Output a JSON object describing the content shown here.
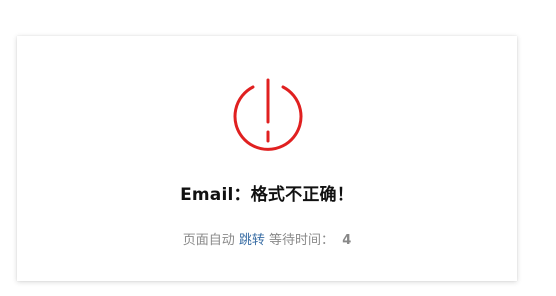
{
  "icon": {
    "name": "power-warning-icon",
    "color": "#e02020"
  },
  "message": "Email：格式不正确！",
  "redirect": {
    "prefix": "页面自动",
    "link_label": "跳转",
    "suffix": "等待时间：",
    "countdown": "4"
  }
}
